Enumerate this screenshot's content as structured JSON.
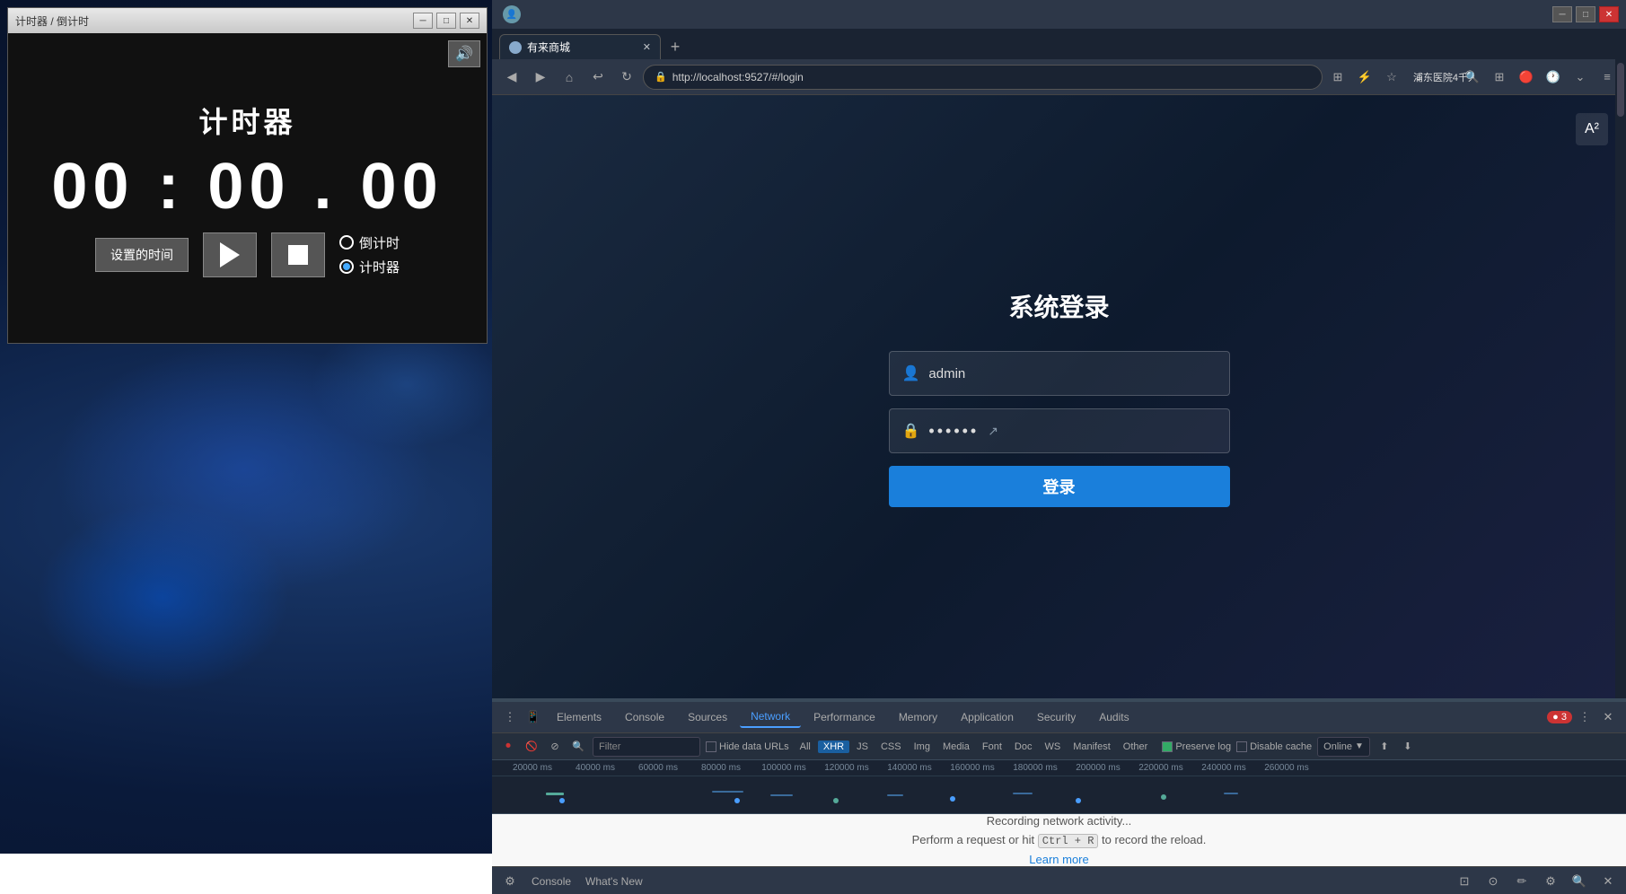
{
  "desktop": {
    "background_desc": "dark blue nebula space background"
  },
  "timer_window": {
    "title": "计时器 / 倒计时",
    "heading": "计时器",
    "display": "00 : 00 . 00",
    "set_time_label": "设置的时间",
    "play_label": "▶",
    "stop_label": "■",
    "countdown_label": "倒计时",
    "timer_label": "计时器",
    "volume_icon": "🔊",
    "min_btn": "─",
    "max_btn": "□",
    "close_btn": "✕"
  },
  "browser": {
    "tab_label": "有来商城",
    "new_tab_icon": "+",
    "back_icon": "◀",
    "forward_icon": "▶",
    "home_icon": "⌂",
    "refresh_back_icon": "↩",
    "refresh_icon": "↻",
    "address": "http://localhost:9527/#/login",
    "extensions_icon": "⊞",
    "star_icon": "★",
    "extension2_icon": "⊞",
    "titlebar_close": "✕",
    "titlebar_max": "□",
    "titlebar_min": "─",
    "profile_icon": "👤",
    "right_icons": [
      "⊞",
      "⚡",
      "☆",
      "⌄",
      "浦东医院4千人",
      "🔍",
      "⊞",
      "🔴",
      "🕐",
      "⌄",
      "≡"
    ]
  },
  "login_page": {
    "title": "系统登录",
    "translate_icon": "A²",
    "username_placeholder": "admin",
    "username_icon": "👤",
    "password_value": "••••••",
    "password_icon": "🔒",
    "eye_icon": "👁",
    "login_button": "登录"
  },
  "devtools": {
    "tabs": [
      {
        "label": "Elements",
        "active": false
      },
      {
        "label": "Console",
        "active": false
      },
      {
        "label": "Sources",
        "active": false
      },
      {
        "label": "Network",
        "active": true
      },
      {
        "label": "Performance",
        "active": false
      },
      {
        "label": "Memory",
        "active": false
      },
      {
        "label": "Application",
        "active": false
      },
      {
        "label": "Security",
        "active": false
      },
      {
        "label": "Audits",
        "active": false
      }
    ],
    "error_count": "● 3",
    "filter_placeholder": "Filter",
    "hide_data_urls_label": "Hide data URLs",
    "filter_types": [
      {
        "label": "All",
        "active": false
      },
      {
        "label": "XHR",
        "active": true
      },
      {
        "label": "JS",
        "active": false
      },
      {
        "label": "CSS",
        "active": false
      },
      {
        "label": "Img",
        "active": false
      },
      {
        "label": "Media",
        "active": false
      },
      {
        "label": "Font",
        "active": false
      },
      {
        "label": "Doc",
        "active": false
      },
      {
        "label": "WS",
        "active": false
      },
      {
        "label": "Manifest",
        "active": false
      },
      {
        "label": "Other",
        "active": false
      }
    ],
    "preserve_log_label": "Preserve log",
    "disable_cache_label": "Disable cache",
    "online_label": "Online",
    "timeline_marks": [
      "20000 ms",
      "40000 ms",
      "60000 ms",
      "80000 ms",
      "100000 ms",
      "120000 ms",
      "140000 ms",
      "160000 ms",
      "180000 ms",
      "200000 ms",
      "220000 ms",
      "240000 ms",
      "260000 ms"
    ],
    "recording_text": "Recording network activity...",
    "perform_text": "Perform a request or hit",
    "keyboard_shortcut": "Ctrl + R",
    "record_text": "to record the reload.",
    "learn_more": "Learn more",
    "bottom_tabs": [
      {
        "label": "Console",
        "active": false
      },
      {
        "label": "What's New",
        "active": false
      }
    ]
  }
}
